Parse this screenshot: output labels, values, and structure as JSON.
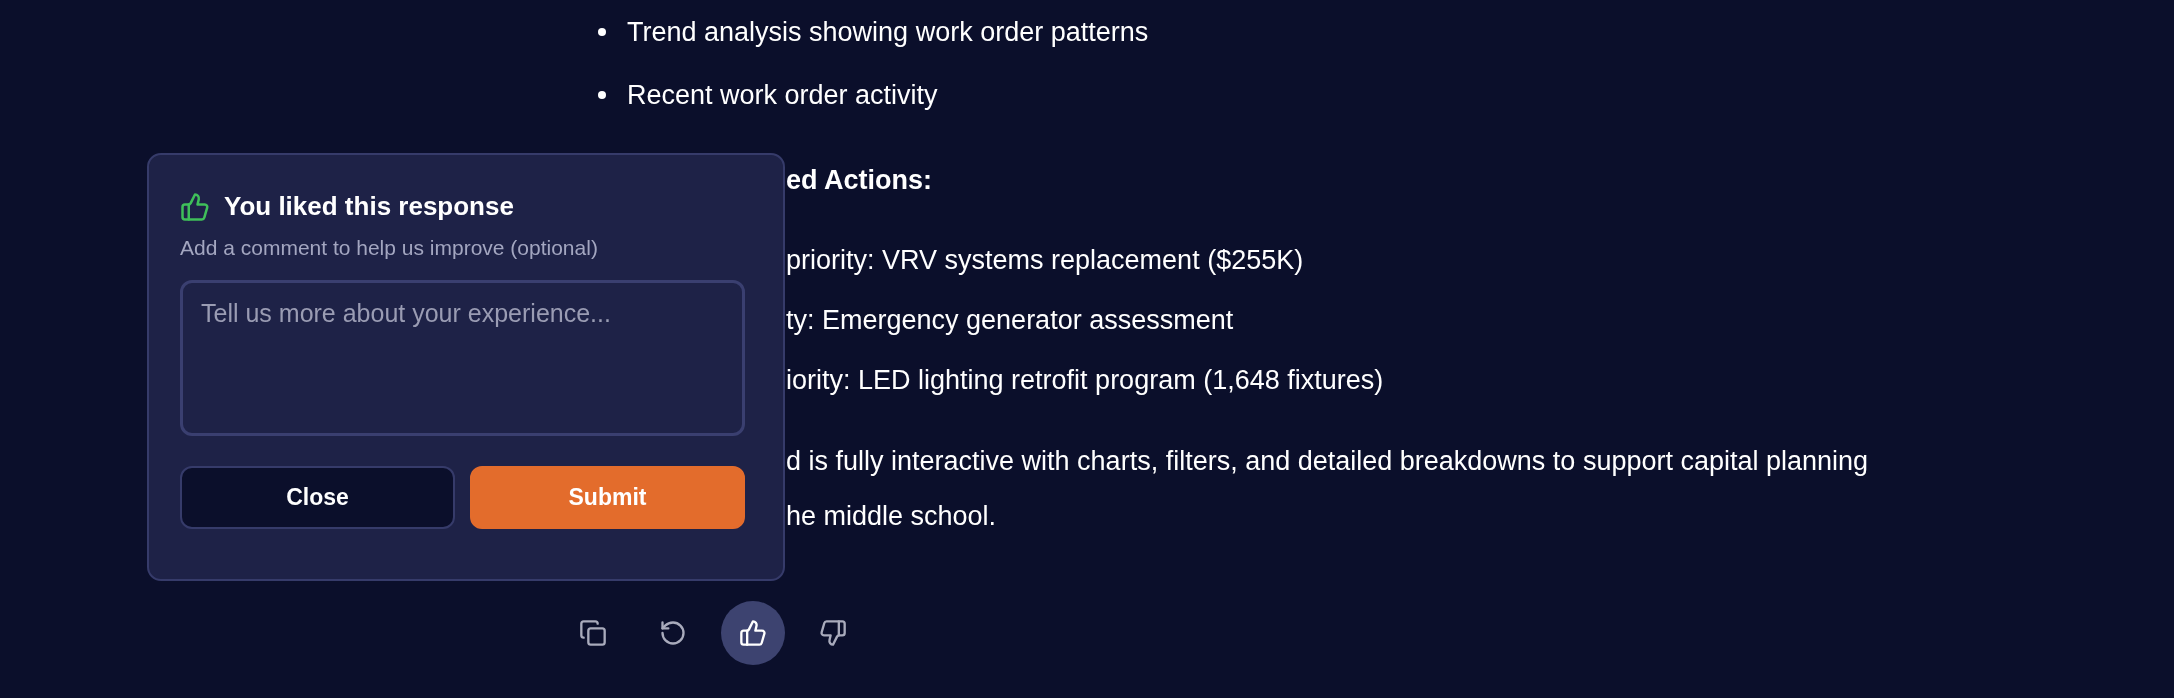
{
  "response": {
    "blocks": [
      {
        "kind": "bullet",
        "text": "Trend analysis showing work order patterns"
      },
      {
        "kind": "bullet",
        "text": "Recent work order activity"
      },
      {
        "kind": "heading",
        "text": "ed Actions:"
      },
      {
        "kind": "line",
        "text": "priority: VRV systems replacement ($255K)"
      },
      {
        "kind": "line",
        "text": "ty: Emergency generator assessment"
      },
      {
        "kind": "line",
        "text": "iority: LED lighting retrofit program (1,648 fixtures)"
      },
      {
        "kind": "line",
        "text": "d is fully interactive with charts, filters, and detailed breakdowns to support capital planning"
      },
      {
        "kind": "line",
        "text": "he middle school."
      }
    ]
  },
  "actions": [
    {
      "kind": "copy",
      "selected": false
    },
    {
      "kind": "regenerate",
      "selected": false
    },
    {
      "kind": "like",
      "selected": true
    },
    {
      "kind": "dislike",
      "selected": false
    }
  ],
  "feedback_popup": {
    "title": "You liked this response",
    "subtitle": "Add a comment to help us improve (optional)",
    "comment": {
      "placeholder": "Tell us more about your experience..."
    },
    "buttons": [
      {
        "label": "Close",
        "kind": "secondary"
      },
      {
        "label": "Submit",
        "kind": "primary"
      }
    ]
  }
}
